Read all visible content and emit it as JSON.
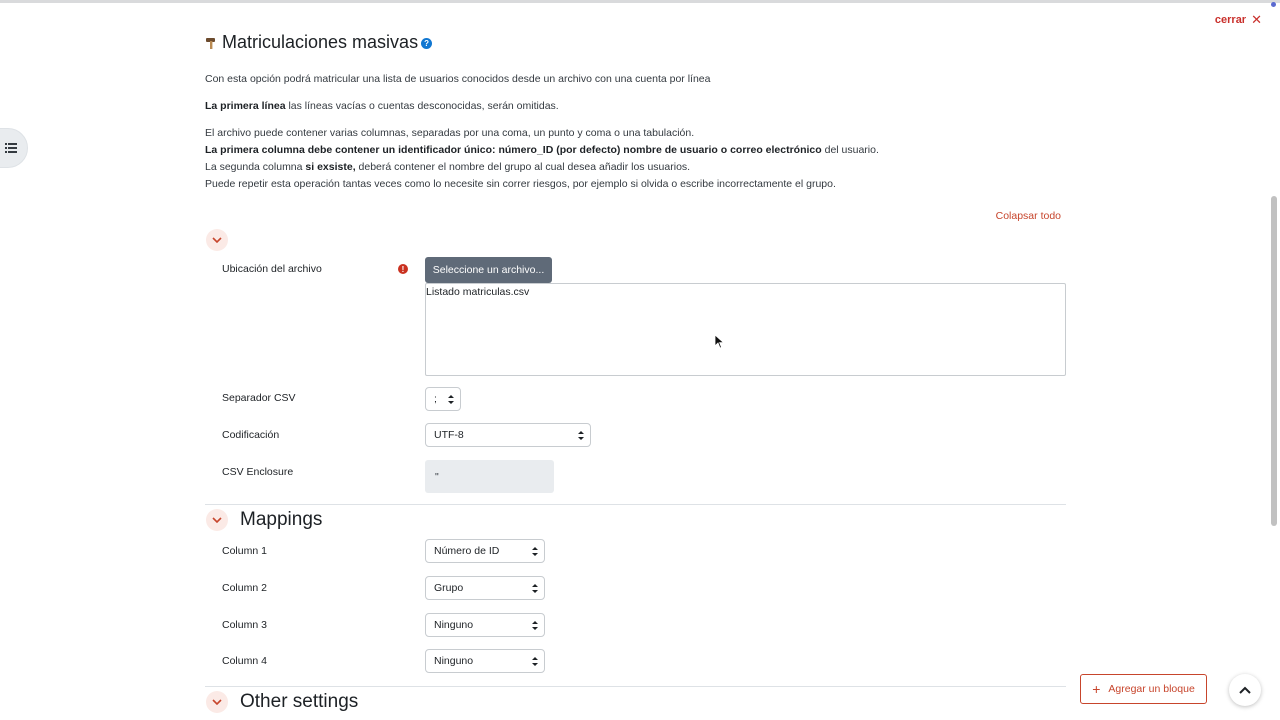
{
  "header": {
    "close_label": "cerrar",
    "title": "Matriculaciones masivas",
    "help_glyph": "?"
  },
  "intro": {
    "line1": "Con esta opción podrá matricular una lista de usuarios conocidos desde un archivo con una cuenta por línea",
    "line2_bold": "La primera línea",
    "line2_rest": " las líneas vacías o cuentas desconocidas, serán omitidas.",
    "line3": "El archivo puede contener varias columnas, separadas por una coma, un punto y coma o una tabulación.",
    "line4_bold": "La primera columna debe contener un identificador único: número_ID (por defecto) nombre de usuario o correo electrónico",
    "line4_rest": " del usuario.",
    "line5_pre": "La segunda columna ",
    "line5_bold": "si exsiste,",
    "line5_rest": " deberá contener el nombre del grupo al cual desea añadir los usuarios.",
    "line6": "Puede repetir esta operación tantas veces como lo necesite sin correr riesgos, por ejemplo si olvida o escribe incorrectamente el grupo."
  },
  "collapse_all": "Colapsar todo",
  "file_section": {
    "file_label": "Ubicación del archivo",
    "required_glyph": "!",
    "choose_button": "Seleccione un archivo...",
    "selected_file": "Listado matriculas.csv",
    "separator_label": "Separador CSV",
    "separator_value": ";",
    "encoding_label": "Codificación",
    "encoding_value": "UTF-8",
    "enclosure_label": "CSV Enclosure",
    "enclosure_value": "\""
  },
  "mappings": {
    "title": "Mappings",
    "rows": [
      {
        "label": "Column 1",
        "value": "Número de ID"
      },
      {
        "label": "Column 2",
        "value": "Grupo"
      },
      {
        "label": "Column 3",
        "value": "Ninguno"
      },
      {
        "label": "Column 4",
        "value": "Ninguno"
      }
    ]
  },
  "other_settings": {
    "title": "Other settings"
  },
  "footer": {
    "add_block": "Agregar un bloque"
  },
  "colors": {
    "accent": "#c7452c",
    "danger": "#ca3120",
    "button_gray": "#5f6a78",
    "help_blue": "#1177d1"
  },
  "icons": [
    "hammer-icon",
    "help-icon",
    "close-icon",
    "list-icon",
    "chevron-down-icon",
    "error-icon",
    "caret-updown-icon",
    "plus-icon",
    "chevron-up-icon"
  ]
}
